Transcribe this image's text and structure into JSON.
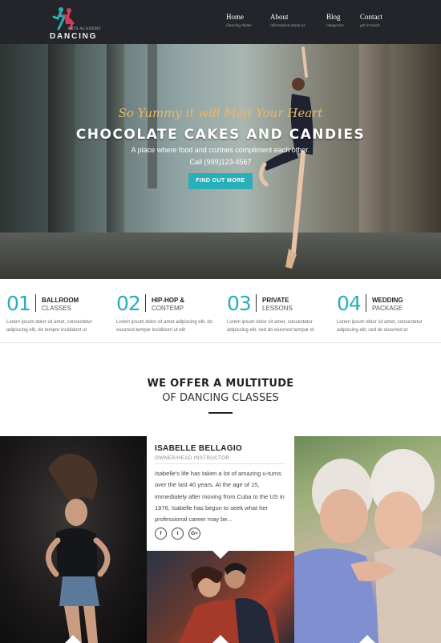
{
  "header": {
    "logo_small": "ARTS ACADEMY",
    "logo_big": "DANCING",
    "nav": [
      {
        "label": "Home",
        "sub": "Dancing theme"
      },
      {
        "label": "About",
        "sub": "information about us"
      },
      {
        "label": "Blog",
        "sub": "categories"
      },
      {
        "label": "Contact",
        "sub": "get in touch"
      }
    ]
  },
  "hero": {
    "script": "So Yummy it will Melt Your Heart",
    "title": "CHOCOLATE CAKES AND CANDIES",
    "subtitle": "A place where food and cozines compliment each other.",
    "phone": "Call (999)123-4567",
    "button": "FIND OUT MORE"
  },
  "features": [
    {
      "num": "01",
      "line1": "BALLROOM",
      "line2": "CLASSES",
      "text": "Lorem ipsum dolor sit amet, consectetur adipiscing elit, do tempor incididunt ut"
    },
    {
      "num": "02",
      "line1": "HIP-HOP &",
      "line2": "CONTEMP",
      "text": "Lorem ipsum dolor sit amet adipiscing elit, do eiusmod tempor incididunt ut elit"
    },
    {
      "num": "03",
      "line1": "PRIVATE",
      "line2": "LESSONS",
      "text": "Lorem ipsum dolor sit amet, consectetur adipiscing elit, sed do eiusmod tempor et"
    },
    {
      "num": "04",
      "line1": "WEDDING",
      "line2": "PACKAGE",
      "text": "Lorem ipsum dolor sit amet, consectetur adipiscing elit, sed do eiusmod et"
    }
  ],
  "offer": {
    "title": "WE OFFER A MULTITUDE",
    "subtitle": "OF DANCING CLASSES"
  },
  "instructor": {
    "name": "ISABELLE BELLAGIO",
    "role": "OWNER/HEAD INSTRUCTOR",
    "bio": "Isabelle's life has taken a lot of amazing u-turns over the last 40 years. At the age of 15, immediately after moving from Cuba to the US in 1976, Isabelle has begun to seek what her professional career may be...",
    "social": [
      "f",
      "t",
      "G+"
    ]
  },
  "colors": {
    "accent": "#2aaeb8",
    "header_bg": "#23252a",
    "script": "#e8b866"
  }
}
